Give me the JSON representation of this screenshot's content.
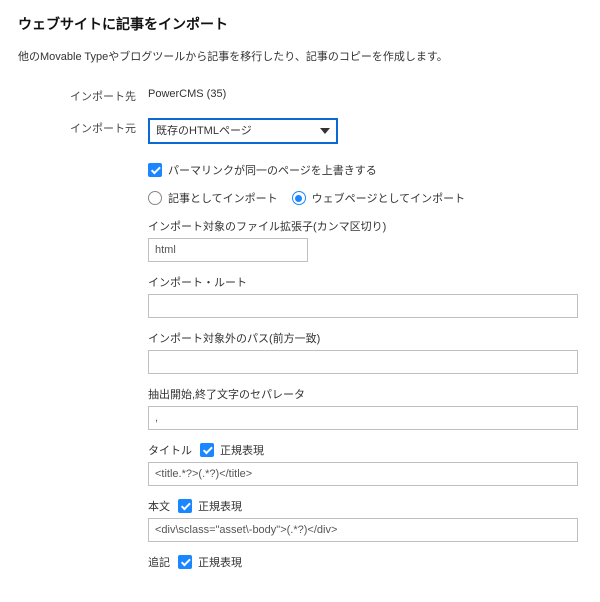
{
  "page": {
    "title": "ウェブサイトに記事をインポート",
    "intro": "他のMovable Typeやブログツールから記事を移行したり、記事のコピーを作成します。"
  },
  "import_target": {
    "label": "インポート先",
    "value": "PowerCMS (35)"
  },
  "import_source": {
    "label": "インポート元",
    "selected": "既存のHTMLページ"
  },
  "options": {
    "overwrite_permalink": {
      "label": "パーマリンクが同一のページを上書きする",
      "checked": true
    },
    "import_as": {
      "entry_label": "記事としてインポート",
      "page_label": "ウェブページとしてインポート",
      "selected": "page"
    },
    "file_ext": {
      "label": "インポート対象のファイル拡張子(カンマ区切り)",
      "value": "html"
    },
    "import_root": {
      "label": "インポート・ルート",
      "value": ""
    },
    "exclude_path": {
      "label": "インポート対象外のパス(前方一致)",
      "value": ""
    },
    "separator": {
      "label": "抽出開始,終了文字のセパレータ",
      "value": ","
    },
    "title_pattern": {
      "label": "タイトル",
      "regex_label": "正規表現",
      "regex_checked": true,
      "value": "<title.*?>(.*?)</title>"
    },
    "body_pattern": {
      "label": "本文",
      "regex_label": "正規表現",
      "regex_checked": true,
      "value": "<div\\sclass=\"asset\\-body\">(.*?)</div>"
    },
    "extended_pattern": {
      "label": "追記",
      "regex_label": "正規表現",
      "regex_checked": true
    }
  }
}
